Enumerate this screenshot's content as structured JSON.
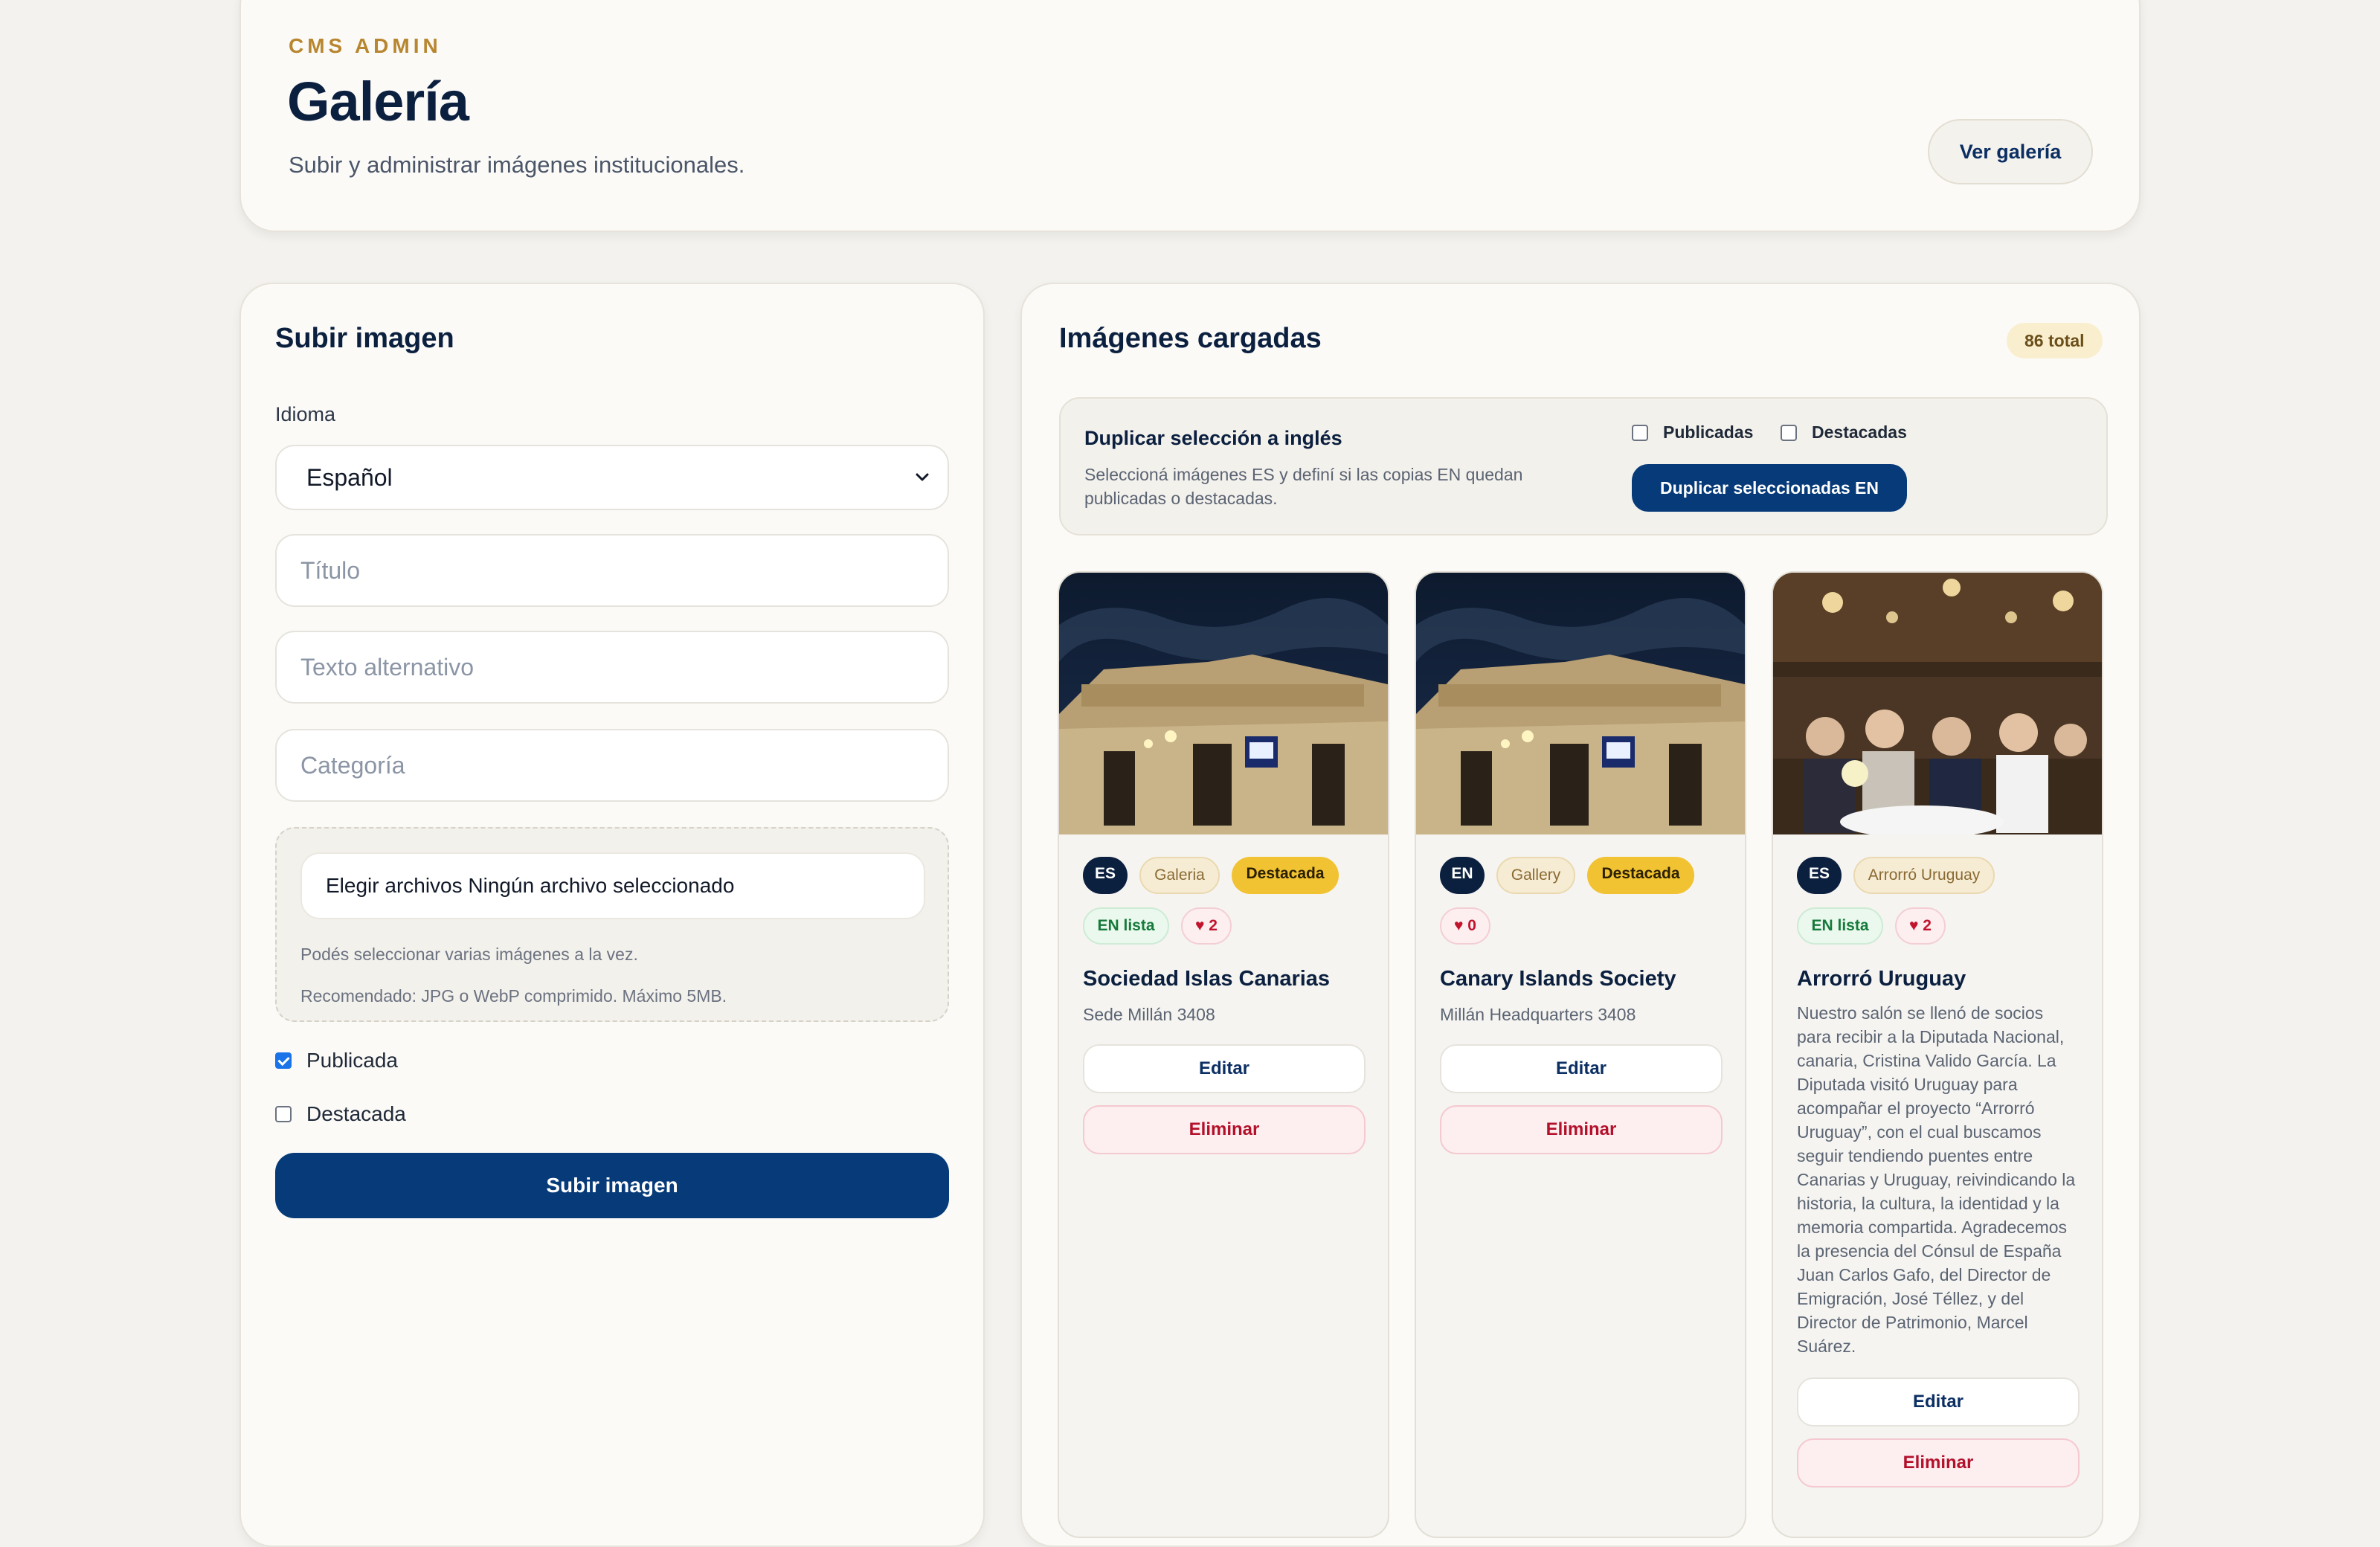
{
  "header": {
    "eyebrow": "CMS ADMIN",
    "title": "Galería",
    "subtitle": "Subir y administrar imágenes institucionales.",
    "view_gallery_label": "Ver galería"
  },
  "upload": {
    "heading": "Subir imagen",
    "language_label": "Idioma",
    "language_value": "Español",
    "title_placeholder": "Título",
    "alt_placeholder": "Texto alternativo",
    "category_placeholder": "Categoría",
    "file_picker_text": "Elegir archivos Ningún archivo seleccionado",
    "hint_multiple": "Podés seleccionar varias imágenes a la vez.",
    "hint_recommended": "Recomendado: JPG o WebP comprimido. Máximo 5MB.",
    "published_label": "Publicada",
    "published_checked": true,
    "featured_label": "Destacada",
    "featured_checked": false,
    "submit_label": "Subir imagen"
  },
  "images": {
    "heading": "Imágenes cargadas",
    "total_badge": "86 total",
    "duplicate": {
      "title": "Duplicar selección a inglés",
      "description": "Seleccioná imágenes ES y definí si las copias EN quedan publicadas o destacadas.",
      "published_label": "Publicadas",
      "featured_label": "Destacadas",
      "button_label": "Duplicar seleccionadas EN"
    },
    "cards": [
      {
        "lang": "ES",
        "category": "Galeria",
        "featured": "Destacada",
        "en_ready": "EN lista",
        "likes": "♥ 2",
        "title": "Sociedad Islas Canarias",
        "description": "Sede Millán 3408",
        "edit_label": "Editar",
        "delete_label": "Eliminar"
      },
      {
        "lang": "EN",
        "category": "Gallery",
        "featured": "Destacada",
        "likes": "♥ 0",
        "title": "Canary Islands Society",
        "description": "Millán Headquarters 3408",
        "edit_label": "Editar",
        "delete_label": "Eliminar"
      },
      {
        "lang": "ES",
        "category": "Arrorró Uruguay",
        "en_ready": "EN lista",
        "likes": "♥ 2",
        "title": "Arrorró Uruguay",
        "description": "Nuestro salón se llenó de socios para recibir a la Diputada Nacional, canaria, Cristina Valido García. La Diputada visitó Uruguay para acompañar el proyecto “Arrorró Uruguay”, con el cual buscamos seguir tendiendo puentes entre Canarias y Uruguay, reivindicando la historia, la cultura, la identidad y la memoria compartida. Agradecemos la presencia del Cónsul de España Juan Carlos Gafo, del Director de Emigración, José Téllez, y del Director de Patrimonio, Marcel Suárez.",
        "edit_label": "Editar",
        "delete_label": "Eliminar"
      }
    ]
  },
  "colors": {
    "primary": "#063a78",
    "accent_gold": "#b8862f",
    "featured_badge": "#f1c232",
    "danger": "#b3102a"
  },
  "icons": {
    "select_chevron": "chevron-down-icon",
    "like": "heart-icon"
  }
}
